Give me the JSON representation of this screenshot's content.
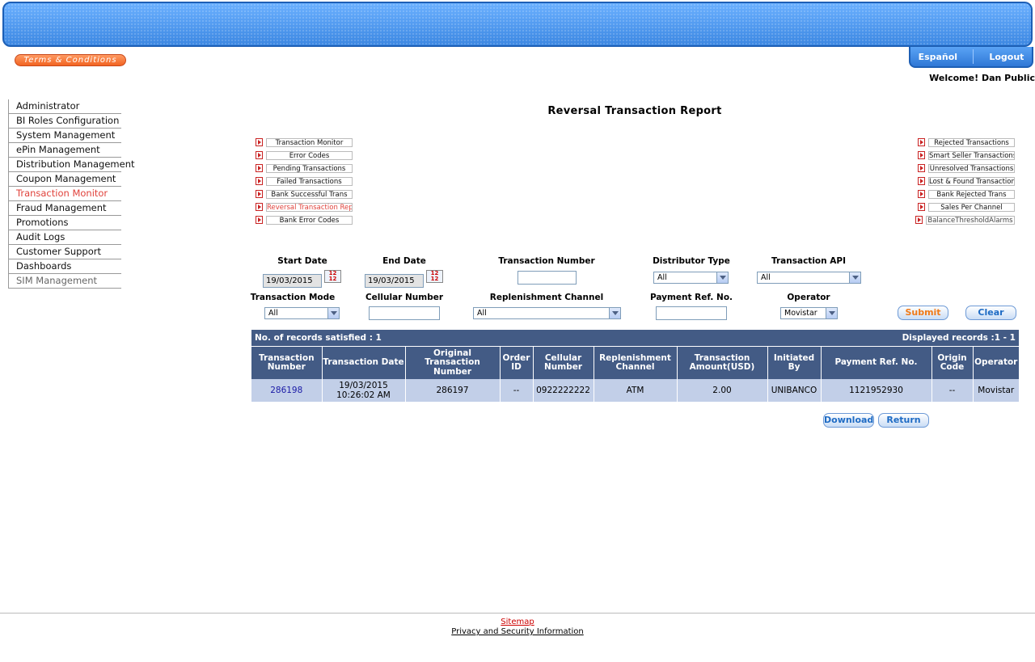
{
  "header": {
    "terms_label": "Terms & Conditions",
    "language_label": "Español",
    "logout_label": "Logout",
    "welcome": "Welcome! Dan Public"
  },
  "sidebar": {
    "items": [
      {
        "label": "Administrator"
      },
      {
        "label": "BI Roles Configuration"
      },
      {
        "label": "System Management"
      },
      {
        "label": "ePin Management"
      },
      {
        "label": "Distribution Management"
      },
      {
        "label": "Coupon Management"
      },
      {
        "label": "Transaction Monitor"
      },
      {
        "label": "Fraud Management"
      },
      {
        "label": "Promotions"
      },
      {
        "label": "Audit Logs"
      },
      {
        "label": "Customer Support"
      },
      {
        "label": "Dashboards"
      },
      {
        "label": "SIM Management"
      }
    ]
  },
  "page": {
    "title": "Reversal Transaction Report"
  },
  "report_links": {
    "left": [
      "Transaction Monitor",
      "Error Codes",
      "Pending Transactions",
      "Failed Transactions",
      "Bank Successful Trans",
      "Reversal Transaction Report",
      "Bank Error Codes"
    ],
    "right": [
      "Rejected Transactions",
      "Smart Seller Transactions",
      "Unresolved Transactions",
      "Lost & Found Transactions",
      "Bank Rejected Trans",
      "Sales Per Channel",
      "BalanceThresholdAlarms"
    ]
  },
  "filters": {
    "start_date_label": "Start Date",
    "start_date_value": "19/03/2015",
    "end_date_label": "End Date",
    "end_date_value": "19/03/2015",
    "transaction_number_label": "Transaction Number",
    "distributor_type_label": "Distributor Type",
    "distributor_type_value": "All",
    "transaction_api_label": "Transaction API",
    "transaction_api_value": "All",
    "transaction_mode_label": "Transaction Mode",
    "transaction_mode_value": "All",
    "cellular_number_label": "Cellular Number",
    "replenishment_channel_label": "Replenishment Channel",
    "replenishment_channel_value": "All",
    "payment_ref_label": "Payment Ref. No.",
    "operator_label": "Operator",
    "operator_value": "Movistar",
    "submit_label": "Submit",
    "clear_label": "Clear"
  },
  "results": {
    "records_satisfied": "No. of records satisfied : 1",
    "displayed_records": "Displayed records :1 - 1",
    "columns": [
      "Transaction Number",
      "Transaction Date",
      "Original Transaction Number",
      "Order ID",
      "Cellular Number",
      "Replenishment Channel",
      "Transaction Amount(USD)",
      "Initiated By",
      "Payment Ref. No.",
      "Origin Code",
      "Operator"
    ],
    "rows": [
      {
        "transaction_number": "286198",
        "transaction_date": "19/03/2015 10:26:02 AM",
        "original_transaction_number": "286197",
        "order_id": "--",
        "cellular_number": "0922222222",
        "replenishment_channel": "ATM",
        "amount": "2.00",
        "initiated_by": "UNIBANCO",
        "payment_ref": "1121952930",
        "origin_code": "--",
        "operator": "Movistar"
      }
    ],
    "download_label": "Download",
    "return_label": "Return"
  },
  "footer": {
    "sitemap": "Sitemap",
    "privacy": "Privacy and Security Information"
  }
}
